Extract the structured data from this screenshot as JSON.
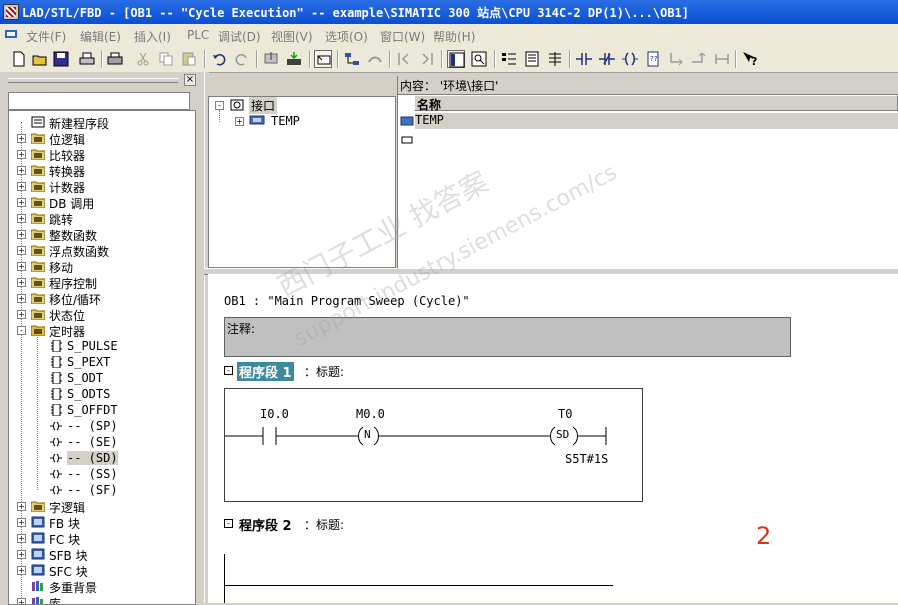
{
  "window": {
    "title": "LAD/STL/FBD  - [OB1 -- \"Cycle Execution\" -- example\\SIMATIC 300 站点\\CPU 314C-2 DP(1)\\...\\OB1]"
  },
  "menu": [
    "文件(F)",
    "编辑(E)",
    "插入(I)",
    "PLC",
    "调试(D)",
    "视图(V)",
    "选项(O)",
    "窗口(W)",
    "帮助(H)"
  ],
  "toolbar": {
    "icons": [
      "new-icon",
      "open-icon",
      "save-icon",
      "print-icon",
      "cut-icon",
      "copy-icon",
      "paste-icon",
      "undo-icon",
      "redo-icon",
      "download-icon",
      "load-icon",
      "overview-icon",
      "network-icon",
      "monitor-icon",
      "step-icon",
      "ladder-view-icon",
      "fbd-view-icon",
      "program-elements-icon",
      "symbol-icon",
      "address-icon",
      "no-contact-icon",
      "nc-contact-icon",
      "coil-icon",
      "box-icon",
      "branch-open-icon",
      "branch-close-icon",
      "connect-icon",
      "help-icon"
    ]
  },
  "program_elements": {
    "items": [
      {
        "label": "新建程序段",
        "icon": "new-network-icon",
        "expand": ""
      },
      {
        "label": "位逻辑",
        "icon": "bit-logic-icon",
        "expand": "+"
      },
      {
        "label": "比较器",
        "icon": "comparator-icon",
        "expand": "+"
      },
      {
        "label": "转换器",
        "icon": "converter-icon",
        "expand": "+"
      },
      {
        "label": "计数器",
        "icon": "counter-icon",
        "expand": "+"
      },
      {
        "label": "DB 调用",
        "icon": "db-call-icon",
        "expand": "+"
      },
      {
        "label": "跳转",
        "icon": "jump-icon",
        "expand": "+"
      },
      {
        "label": "整数函数",
        "icon": "integer-icon",
        "expand": "+"
      },
      {
        "label": "浮点数函数",
        "icon": "float-icon",
        "expand": "+"
      },
      {
        "label": "移动",
        "icon": "move-icon",
        "expand": "+"
      },
      {
        "label": "程序控制",
        "icon": "program-control-icon",
        "expand": "+"
      },
      {
        "label": "移位/循环",
        "icon": "shift-icon",
        "expand": "+"
      },
      {
        "label": "状态位",
        "icon": "status-bit-icon",
        "expand": "+"
      },
      {
        "label": "定时器",
        "icon": "timer-icon",
        "expand": "-"
      },
      {
        "label": "S_PULSE",
        "icon": "timer-box-icon",
        "expand": "",
        "child": true
      },
      {
        "label": "S_PEXT",
        "icon": "timer-box-icon",
        "expand": "",
        "child": true
      },
      {
        "label": "S_ODT",
        "icon": "timer-box-icon",
        "expand": "",
        "child": true
      },
      {
        "label": "S_ODTS",
        "icon": "timer-box-icon",
        "expand": "",
        "child": true
      },
      {
        "label": "S_OFFDT",
        "icon": "timer-box-icon",
        "expand": "",
        "child": true
      },
      {
        "label": "-- (SP)",
        "icon": "timer-coil-icon",
        "expand": "",
        "child": true
      },
      {
        "label": "-- (SE)",
        "icon": "timer-coil-icon",
        "expand": "",
        "child": true
      },
      {
        "label": "-- (SD)",
        "icon": "timer-coil-icon",
        "expand": "",
        "child": true,
        "selected": true
      },
      {
        "label": "-- (SS)",
        "icon": "timer-coil-icon",
        "expand": "",
        "child": true
      },
      {
        "label": "-- (SF)",
        "icon": "timer-coil-icon",
        "expand": "",
        "child": true
      },
      {
        "label": "字逻辑",
        "icon": "word-logic-icon",
        "expand": "+"
      },
      {
        "label": "FB 块",
        "icon": "fb-block-icon",
        "expand": "+"
      },
      {
        "label": "FC 块",
        "icon": "fc-block-icon",
        "expand": "+"
      },
      {
        "label": "SFB 块",
        "icon": "sfb-block-icon",
        "expand": "+"
      },
      {
        "label": "SFC 块",
        "icon": "sfc-block-icon",
        "expand": "+"
      },
      {
        "label": "多重背景",
        "icon": "multi-instance-icon",
        "expand": ""
      },
      {
        "label": "库",
        "icon": "library-icon",
        "expand": "+"
      }
    ]
  },
  "interface": {
    "root": "接口",
    "child": "TEMP",
    "content_header": "内容：  '环境\\接口'",
    "column_name": "名称",
    "rows": [
      "TEMP"
    ]
  },
  "editor": {
    "block_title": "OB1 :  \"Main Program Sweep (Cycle)\"",
    "comment_label": "注释:",
    "network1": {
      "label": "程序段",
      "number": "1",
      "title": "：标题:"
    },
    "network2": {
      "label": "程序段",
      "number": "2",
      "title": "：标题:"
    },
    "ladder": {
      "contact1": "I0.0",
      "contact2": "M0.0",
      "coil_n": "N",
      "timer": "T0",
      "timer_coil": "SD",
      "timer_value": "S5T#1S"
    },
    "annotation": "2"
  },
  "watermark": {
    "line1": "找答案",
    "line2": "support.industry.siemens.com/cs",
    "line3": "西门子工业"
  }
}
